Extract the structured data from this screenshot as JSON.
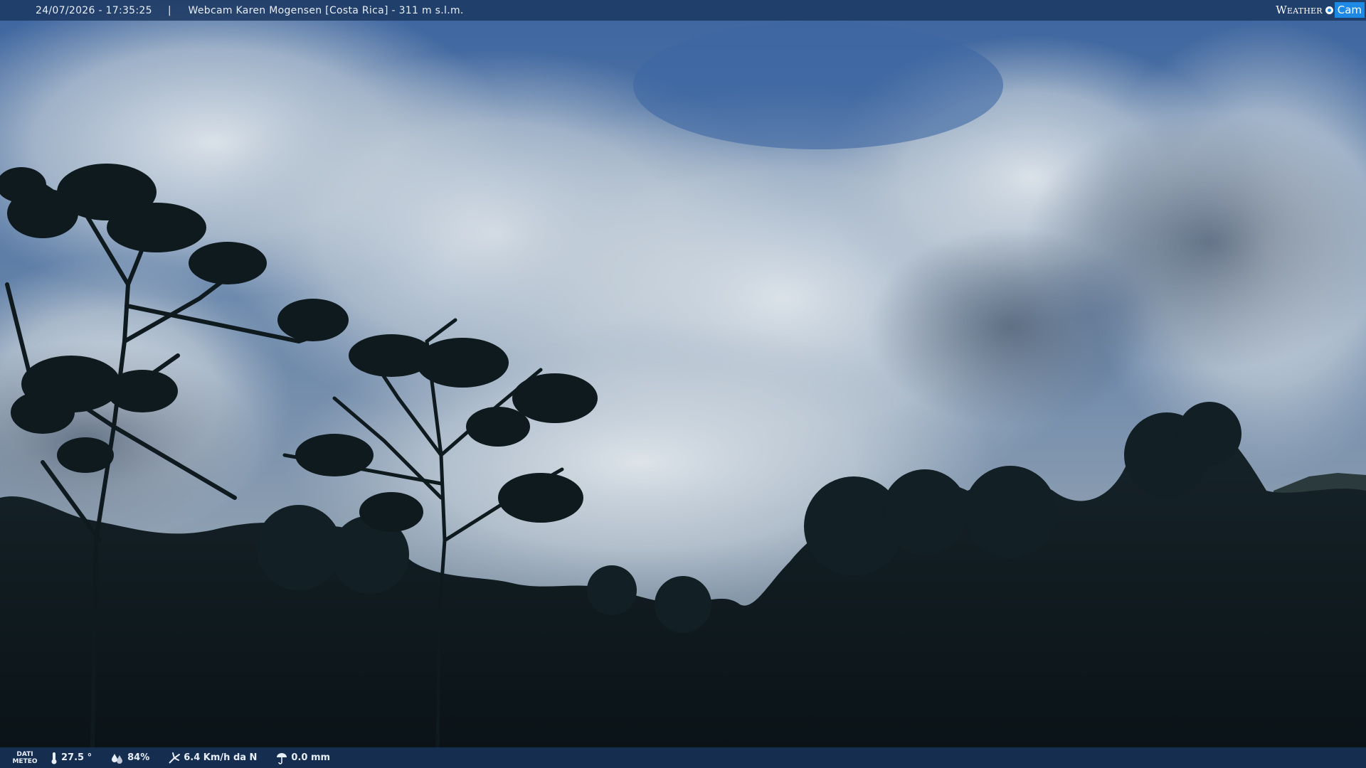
{
  "header": {
    "timestamp": "24/07/2026 - 17:35:25",
    "separator": "|",
    "title": "Webcam Karen Mogensen [Costa Rica]  - 311 m s.l.m."
  },
  "logo": {
    "text_weather": "Weather",
    "text_cam": "Cam"
  },
  "footer": {
    "label_line1": "DATI",
    "label_line2": "METEO",
    "temperature": "27.5 °",
    "humidity": "84%",
    "wind": "6.4 Km/h da N",
    "rain": "0.0 mm",
    "icons": [
      "thermometer-icon",
      "humidity-icon",
      "wind-icon",
      "rain-icon"
    ]
  },
  "colors": {
    "bar": "#1c3862",
    "sky_top": "#3a66a5",
    "clouds": "#c9d3dc",
    "vegetation": "#0f1a1d",
    "logo_accent": "#1e88e5"
  }
}
